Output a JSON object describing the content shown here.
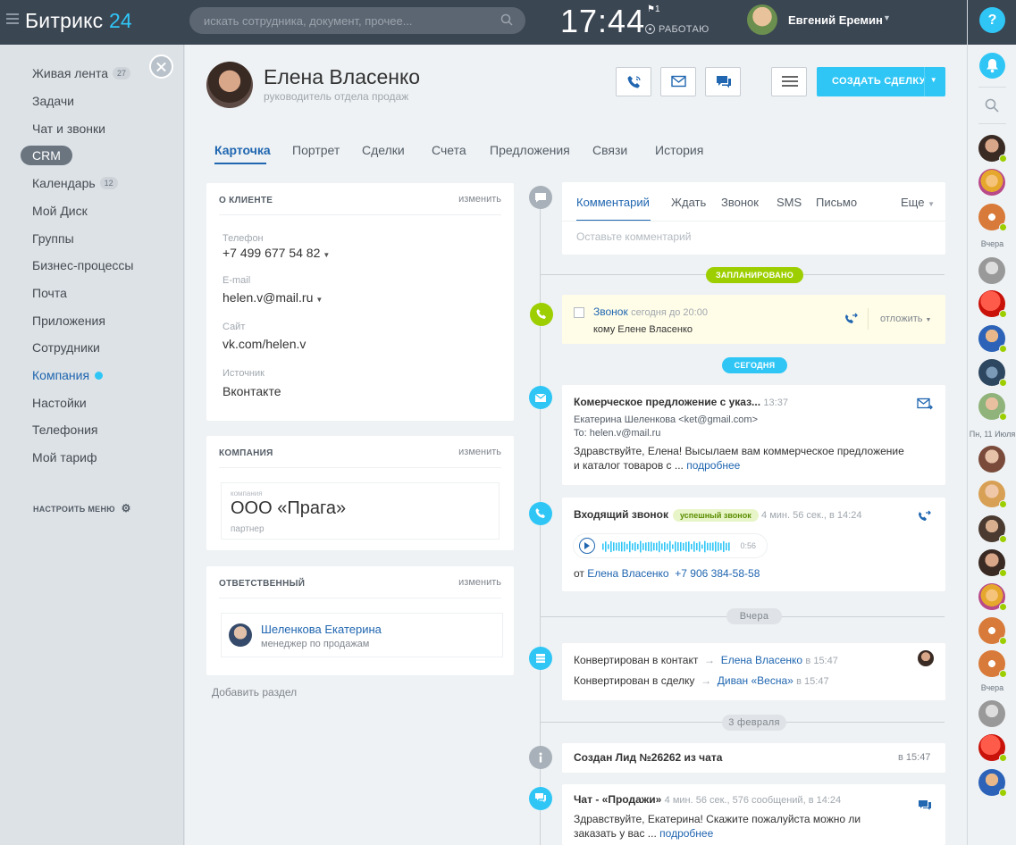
{
  "topbar": {
    "logo": "Битрикс",
    "logo_num": "24",
    "search_placeholder": "искать сотрудника, документ, прочее...",
    "clock": "17:44",
    "flag_count": "1",
    "work_status": "РАБОТАЮ",
    "user_name": "Евгений Еремин"
  },
  "leftmenu": {
    "items": [
      {
        "label": "Живая лента",
        "count": "27"
      },
      {
        "label": "Задачи"
      },
      {
        "label": "Чат и звонки"
      },
      {
        "label": "CRM"
      },
      {
        "label": "Календарь",
        "count": "12"
      },
      {
        "label": "Мой Диск"
      },
      {
        "label": "Группы"
      },
      {
        "label": "Бизнес-процессы"
      },
      {
        "label": "Почта"
      },
      {
        "label": "Приложения"
      },
      {
        "label": "Сотрудники"
      },
      {
        "label": "Компания"
      },
      {
        "label": "Настойки"
      },
      {
        "label": "Телефония"
      },
      {
        "label": "Мой тариф"
      }
    ],
    "config": "НАСТРОИТЬ МЕНЮ"
  },
  "contact": {
    "name": "Елена Власенко",
    "position": "руководитель отдела продаж",
    "create_deal": "СОЗДАТЬ СДЕЛКУ"
  },
  "tabs": [
    "Карточка",
    "Портрет",
    "Сделки",
    "Счета",
    "Предложения",
    "Связи",
    "История"
  ],
  "client": {
    "title": "О КЛИЕНТЕ",
    "edit": "изменить",
    "phone_label": "Телефон",
    "phone": "+7 499 677 54 82",
    "email_label": "E-mail",
    "email": "helen.v@mail.ru",
    "site_label": "Сайт",
    "site": "vk.com/helen.v",
    "source_label": "Источник",
    "source": "Вконтакте"
  },
  "company": {
    "title": "КОМПАНИЯ",
    "edit": "изменить",
    "card_label": "компания",
    "name": "ООО «Прага»",
    "type": "партнер"
  },
  "responsible": {
    "title": "ОТВЕТСТВЕННЫЙ",
    "edit": "изменить",
    "name": "Шеленкова Екатерина",
    "position": "менеджер по продажам"
  },
  "add_section": "Добавить раздел",
  "composer": {
    "tabs": [
      "Комментарий",
      "Ждать",
      "Звонок",
      "SMS",
      "Письмо",
      "Еще"
    ],
    "placeholder": "Оставьте комментарий"
  },
  "timeline": {
    "planned": "ЗАПЛАНИРОВАНО",
    "today": "СЕГОДНЯ",
    "yesterday": "Вчера",
    "feb3": "3 февраля",
    "planned_call": {
      "title": "Звонок",
      "time": "сегодня до 20:00",
      "to": "кому Елене Власенко",
      "postpone": "отложить"
    },
    "email": {
      "title": "Комерческое предложение с указ...",
      "time": "13:37",
      "from": "Екатерина Шеленкова <ket@gmail.com>",
      "to": "To: helen.v@mail.ru",
      "body1": "Здравствуйте, Елена! Высылаем вам коммерческое предложение",
      "body2": "и каталог товаров с ...",
      "more": "подробнее"
    },
    "call": {
      "title": "Входящий звонок",
      "badge": "успешный звонок",
      "meta": "4 мин. 56 сек., в 14:24",
      "duration": "0:56",
      "from_label": "от",
      "from_name": "Елена Власенко",
      "from_phone": "+7 906 384-58-58"
    },
    "convert": {
      "line1": "Конвертирован в контакт",
      "target1": "Елена Власенко",
      "time1": "в 15:47",
      "line2": "Конвертирован в сделку",
      "target2": "Диван «Весна»",
      "time2": "в 15:47"
    },
    "lead": {
      "title": "Создан Лид №26262 из чата",
      "time": "в 15:47"
    },
    "chat": {
      "title": "Чат - «Продажи»",
      "meta": "4 мин. 56 сек., 576 сообщений, в 14:24",
      "body1": "Здравствуйте, Екатерина! Скажите пожалуйста можно ли",
      "body2": "заказать у вас ...",
      "more": "подробнее"
    }
  },
  "rightcol": {
    "help": "?",
    "label_yesterday": "Вчера",
    "label_date": "Пн, 11 Июля",
    "label_yesterday2": "Вчера"
  },
  "colors": {
    "accent": "#2fc6f6",
    "topbar": "#3b4653",
    "green": "#9dcf00",
    "link": "#2066b0"
  }
}
